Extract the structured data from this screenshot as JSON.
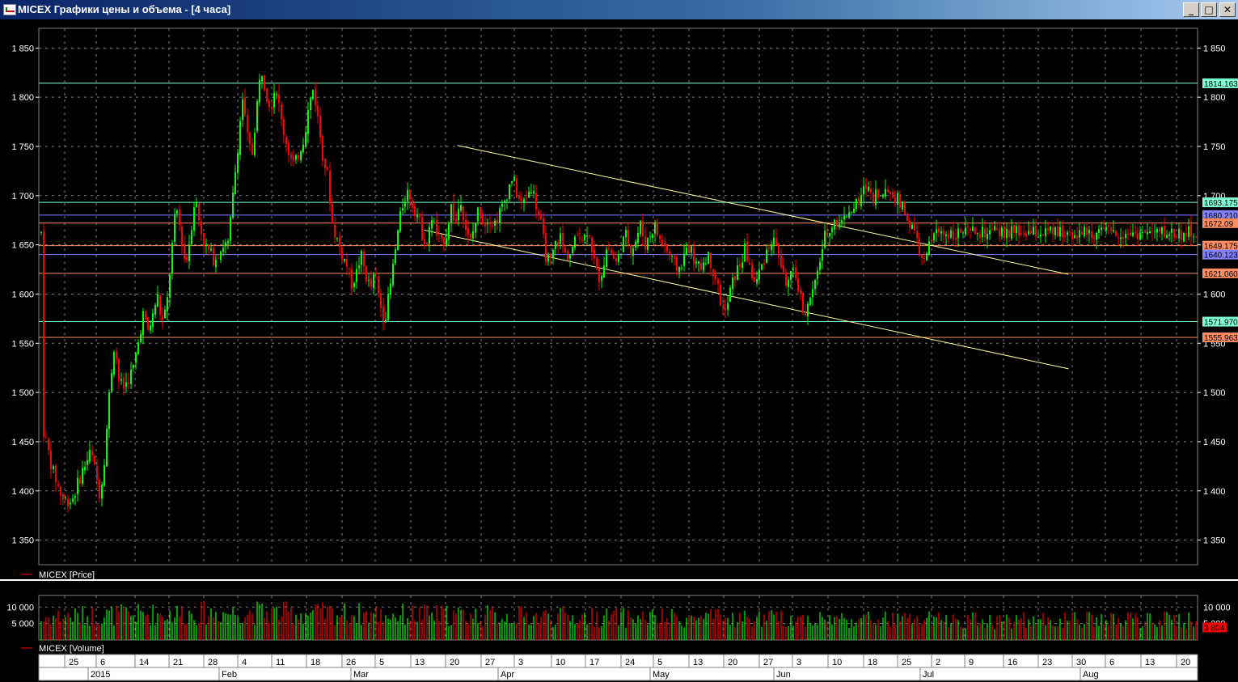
{
  "window": {
    "title": "MICEX Графики цены и объема - [4 часа]",
    "minimize_glyph": "_",
    "maximize_glyph": "□",
    "close_glyph": "✕"
  },
  "colors": {
    "background": "#000000",
    "grid": "#808080",
    "bull": "#00ff00",
    "bear": "#ff0000",
    "trend": "#ffff99"
  },
  "price_panel": {
    "legend": "MICEX [Price]",
    "y_ticks": [
      "1 850",
      "1 800",
      "1 750",
      "1 700",
      "1 650",
      "1 600",
      "1 550",
      "1 500",
      "1 450",
      "1 400",
      "1 350"
    ]
  },
  "volume_panel": {
    "legend": "MICEX [Volume]",
    "y_ticks": [
      "10 000",
      "5 000"
    ],
    "current_label": "3 804"
  },
  "time_axis": {
    "days": [
      "25",
      "6",
      "14",
      "21",
      "28",
      "4",
      "11",
      "18",
      "26",
      "5",
      "13",
      "20",
      "27",
      "3",
      "10",
      "17",
      "24",
      "5",
      "13",
      "20",
      "27",
      "3",
      "10",
      "18",
      "25",
      "2",
      "9",
      "16",
      "23",
      "30",
      "6",
      "13",
      "20"
    ],
    "months": [
      "2015",
      "Feb",
      "Mar",
      "Apr",
      "May",
      "Jun",
      "Jul",
      "Aug"
    ]
  },
  "chart_data": {
    "type": "candlestick",
    "title": "",
    "ylim": [
      1325,
      1870
    ],
    "volume_ylim": [
      0,
      13500
    ],
    "levels": [
      {
        "value": 1814.163,
        "label": "1814.163",
        "color": "#7fffd4",
        "text": "#000000"
      },
      {
        "value": 1693.175,
        "label": "1693.175",
        "color": "#7fffd4",
        "text": "#000000"
      },
      {
        "value": 1680.21,
        "label": "1680.210",
        "color": "#8080ff",
        "text": "#000000"
      },
      {
        "value": 1672.09,
        "label": "1672.09",
        "color": "#ff8c60",
        "text": "#000000"
      },
      {
        "value": 1649.17,
        "label": "1649.175",
        "color": "#ff8c60",
        "text": "#000000"
      },
      {
        "value": 1640.12,
        "label": "1640.123",
        "color": "#8080ff",
        "text": "#000000"
      },
      {
        "value": 1621.06,
        "label": "1621.060",
        "color": "#ff8c60",
        "text": "#000000"
      },
      {
        "value": 1571.97,
        "label": "1571.970",
        "color": "#7fffd4",
        "text": "#000000"
      },
      {
        "value": 1555.96,
        "label": "1555.963",
        "color": "#ff8c60",
        "text": "#000000"
      }
    ],
    "trendlines": [
      {
        "from": [
          "Apr 17",
          1751
        ],
        "to": [
          "Aug 24",
          1620
        ]
      },
      {
        "from": [
          "Apr 10",
          1665
        ],
        "to": [
          "Aug 24",
          1524
        ]
      }
    ],
    "path": [
      [
        "Jan 20",
        1462
      ],
      [
        "Jan 22",
        1420
      ],
      [
        "Jan 24",
        1392
      ],
      [
        "Jan 26",
        1390
      ],
      [
        "Jan 28",
        1418
      ],
      [
        "Jan 30",
        1440
      ],
      [
        "Feb 1",
        1395
      ],
      [
        "Feb 2",
        1440
      ],
      [
        "Feb 3",
        1505
      ],
      [
        "Feb 4",
        1552
      ],
      [
        "Feb 5",
        1510
      ],
      [
        "Feb 6",
        1505
      ],
      [
        "Feb 8",
        1525
      ],
      [
        "Feb 9",
        1550
      ],
      [
        "Feb 10",
        1580
      ],
      [
        "Feb 11",
        1562
      ],
      [
        "Feb 12",
        1575
      ],
      [
        "Feb 13",
        1600
      ],
      [
        "Feb 14",
        1570
      ],
      [
        "Feb 15",
        1585
      ],
      [
        "Feb 16",
        1640
      ],
      [
        "Feb 17",
        1690
      ],
      [
        "Feb 18",
        1662
      ],
      [
        "Feb 19",
        1628
      ],
      [
        "Feb 20",
        1660
      ],
      [
        "Feb 21",
        1700
      ],
      [
        "Feb 22",
        1670
      ],
      [
        "Feb 23",
        1650
      ],
      [
        "Feb 25",
        1635
      ],
      [
        "Feb 27",
        1650
      ],
      [
        "Feb 28",
        1650
      ],
      [
        "Mar 1",
        1700
      ],
      [
        "Mar 2",
        1750
      ],
      [
        "Mar 3",
        1800
      ],
      [
        "Mar 4",
        1760
      ],
      [
        "Mar 5",
        1740
      ],
      [
        "Mar 6",
        1790
      ],
      [
        "Mar 7",
        1830
      ],
      [
        "Mar 8",
        1805
      ],
      [
        "Mar 9",
        1790
      ],
      [
        "Mar 10",
        1815
      ],
      [
        "Mar 11",
        1780
      ],
      [
        "Mar 12",
        1760
      ],
      [
        "Mar 13",
        1740
      ],
      [
        "Mar 14",
        1730
      ],
      [
        "Mar 15",
        1745
      ],
      [
        "Mar 16",
        1760
      ],
      [
        "Mar 17",
        1790
      ],
      [
        "Mar 18",
        1810
      ],
      [
        "Mar 19",
        1775
      ],
      [
        "Mar 20",
        1740
      ],
      [
        "Mar 21",
        1720
      ],
      [
        "Mar 22",
        1670
      ],
      [
        "Mar 23",
        1655
      ],
      [
        "Mar 24",
        1640
      ],
      [
        "Mar 25",
        1630
      ],
      [
        "Mar 26",
        1610
      ],
      [
        "Mar 27",
        1620
      ],
      [
        "Mar 28",
        1640
      ],
      [
        "Mar 29",
        1620
      ],
      [
        "Mar 30",
        1605
      ],
      [
        "Mar 31",
        1620
      ],
      [
        "Apr 1",
        1590
      ],
      [
        "Apr 2",
        1575
      ],
      [
        "Apr 3",
        1600
      ],
      [
        "Apr 4",
        1635
      ],
      [
        "Apr 5",
        1670
      ],
      [
        "Apr 6",
        1695
      ],
      [
        "Apr 7",
        1705
      ],
      [
        "Apr 8",
        1690
      ],
      [
        "Apr 9",
        1680
      ],
      [
        "Apr 10",
        1660
      ],
      [
        "Apr 11",
        1650
      ],
      [
        "Apr 12",
        1680
      ],
      [
        "Apr 13",
        1660
      ],
      [
        "Apr 14",
        1650
      ],
      [
        "Apr 15",
        1660
      ],
      [
        "Apr 16",
        1690
      ],
      [
        "Apr 17",
        1670
      ],
      [
        "Apr 18",
        1700
      ],
      [
        "Apr 19",
        1670
      ],
      [
        "Apr 20",
        1650
      ],
      [
        "Apr 21",
        1670
      ],
      [
        "Apr 22",
        1690
      ],
      [
        "Apr 23",
        1670
      ],
      [
        "Apr 24",
        1680
      ],
      [
        "Apr 25",
        1670
      ],
      [
        "Apr 27",
        1690
      ],
      [
        "Apr 29",
        1720
      ],
      [
        "Apr 30",
        1700
      ],
      [
        "May 1",
        1690
      ],
      [
        "May 2",
        1700
      ],
      [
        "May 3",
        1710
      ],
      [
        "May 4",
        1690
      ],
      [
        "May 5",
        1670
      ],
      [
        "May 6",
        1640
      ],
      [
        "May 7",
        1630
      ],
      [
        "May 8",
        1650
      ],
      [
        "May 9",
        1660
      ],
      [
        "May 10",
        1640
      ],
      [
        "May 11",
        1640
      ],
      [
        "May 12",
        1650
      ],
      [
        "May 13",
        1665
      ],
      [
        "May 14",
        1655
      ],
      [
        "May 15",
        1670
      ],
      [
        "May 16",
        1640
      ],
      [
        "May 17",
        1615
      ],
      [
        "May 18",
        1625
      ],
      [
        "May 19",
        1650
      ],
      [
        "May 20",
        1640
      ],
      [
        "May 21",
        1630
      ],
      [
        "May 22",
        1650
      ],
      [
        "May 23",
        1660
      ],
      [
        "May 24",
        1645
      ],
      [
        "May 25",
        1655
      ],
      [
        "May 26",
        1670
      ],
      [
        "May 27",
        1650
      ],
      [
        "May 28",
        1660
      ],
      [
        "May 29",
        1670
      ],
      [
        "May 30",
        1655
      ],
      [
        "May 31",
        1650
      ],
      [
        "Jun 1",
        1640
      ],
      [
        "Jun 2",
        1630
      ],
      [
        "Jun 3",
        1625
      ],
      [
        "Jun 4",
        1635
      ],
      [
        "Jun 5",
        1650
      ],
      [
        "Jun 6",
        1640
      ],
      [
        "Jun 7",
        1625
      ],
      [
        "Jun 8",
        1630
      ],
      [
        "Jun 9",
        1640
      ],
      [
        "Jun 10",
        1630
      ],
      [
        "Jun 11",
        1615
      ],
      [
        "Jun 12",
        1590
      ],
      [
        "Jun 13",
        1580
      ],
      [
        "Jun 14",
        1605
      ],
      [
        "Jun 15",
        1620
      ],
      [
        "Jun 16",
        1630
      ],
      [
        "Jun 17",
        1645
      ],
      [
        "Jun 18",
        1630
      ],
      [
        "Jun 19",
        1610
      ],
      [
        "Jun 20",
        1620
      ],
      [
        "Jun 21",
        1635
      ],
      [
        "Jun 22",
        1650
      ],
      [
        "Jun 23",
        1655
      ],
      [
        "Jun 24",
        1645
      ],
      [
        "Jun 25",
        1620
      ],
      [
        "Jun 26",
        1610
      ],
      [
        "Jun 27",
        1620
      ],
      [
        "Jun 28",
        1615
      ],
      [
        "Jun 29",
        1590
      ],
      [
        "Jun 30",
        1580
      ],
      [
        "Jul 1",
        1600
      ],
      [
        "Jul 2",
        1610
      ],
      [
        "Jul 3",
        1640
      ],
      [
        "Jul 4",
        1660
      ],
      [
        "Jul 5",
        1668
      ],
      [
        "Jul 6",
        1675
      ],
      [
        "Jul 7",
        1668
      ],
      [
        "Jul 8",
        1685
      ],
      [
        "Jul 9",
        1678
      ],
      [
        "Jul 10",
        1690
      ],
      [
        "Jul 11",
        1690
      ],
      [
        "Jul 12",
        1705
      ],
      [
        "Jul 13",
        1712
      ],
      [
        "Jul 14",
        1698
      ],
      [
        "Jul 15",
        1705
      ],
      [
        "Jul 16",
        1695
      ],
      [
        "Jul 17",
        1708
      ],
      [
        "Jul 18",
        1700
      ],
      [
        "Jul 19",
        1698
      ],
      [
        "Jul 20",
        1690
      ],
      [
        "Jul 21",
        1680
      ],
      [
        "Jul 22",
        1670
      ],
      [
        "Jul 23",
        1660
      ],
      [
        "Jul 24",
        1640
      ],
      [
        "Jul 25",
        1630
      ],
      [
        "Jul 26",
        1650
      ],
      [
        "Jul 27",
        1662
      ]
    ],
    "volume_base": [
      [
        "Jan 20",
        7000
      ],
      [
        "Feb 10",
        7800
      ],
      [
        "Mar 1",
        8400
      ],
      [
        "Mar 20",
        8000
      ],
      [
        "Apr 10",
        7600
      ],
      [
        "May 1",
        7200
      ],
      [
        "Jun 1",
        6600
      ],
      [
        "Jul 1",
        6400
      ],
      [
        "Jul 27",
        6000
      ]
    ]
  }
}
